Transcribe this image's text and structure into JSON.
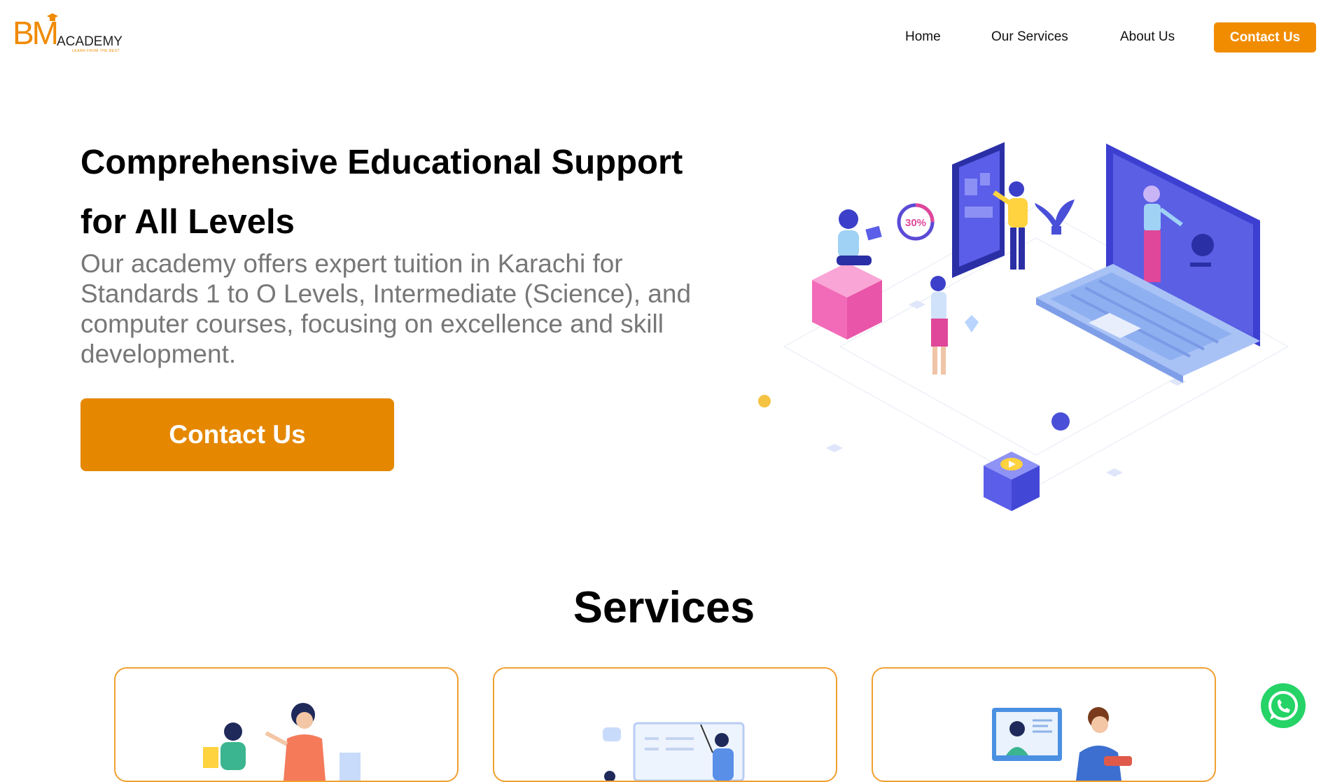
{
  "header": {
    "logo": {
      "primary": "BM",
      "secondary": "ACADEMY",
      "tagline": "LEARN FROM THE BEST"
    },
    "nav": [
      {
        "label": "Home"
      },
      {
        "label": "Our Services"
      },
      {
        "label": "About Us"
      }
    ],
    "cta_label": "Contact Us"
  },
  "hero": {
    "title": "Comprehensive Educational Support for All Levels",
    "description": "Our academy offers expert tuition in Karachi for Standards 1 to O Levels, Intermediate (Science), and computer courses, focusing on excellence and skill development.",
    "cta_label": "Contact Us",
    "illustration_badge": "30%"
  },
  "services": {
    "title": "Services"
  },
  "colors": {
    "brand_orange": "#f18c00",
    "hero_button": "#e58800",
    "card_border": "#f0a030",
    "whatsapp_green": "#25d366"
  },
  "icons": [
    "whatsapp-icon"
  ]
}
